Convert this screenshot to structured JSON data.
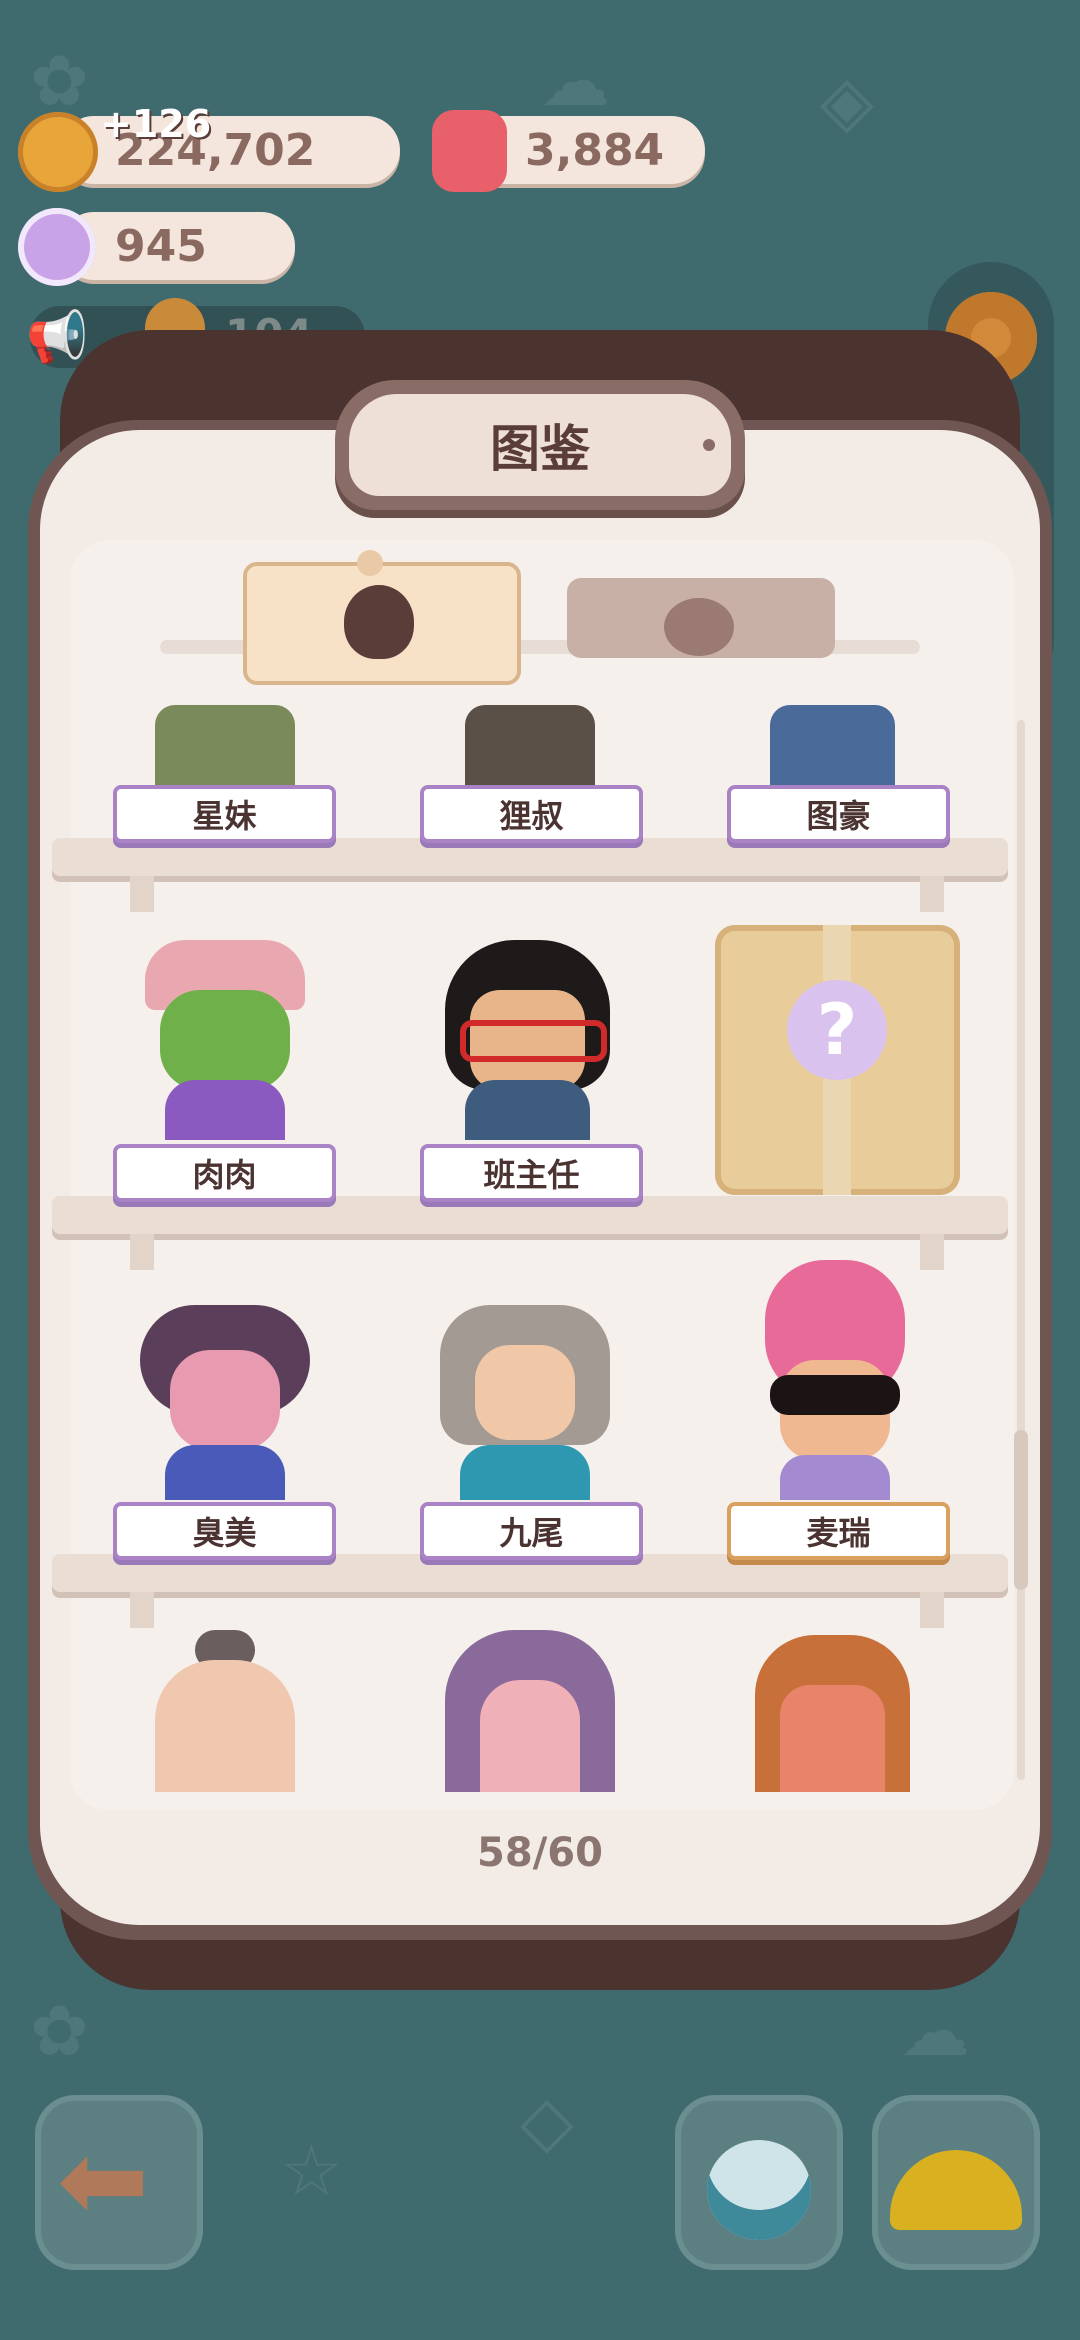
{
  "currencies": {
    "cookies": {
      "value": "224,702",
      "gain": "+126"
    },
    "jelly": {
      "value": "3,884"
    },
    "crystal": {
      "value": "945"
    }
  },
  "notice": {
    "value": "104"
  },
  "panel": {
    "title": "图鉴",
    "tabs": [
      {
        "icon": "character-face-icon",
        "active": true
      },
      {
        "icon": "pet-face-icon",
        "active": false
      }
    ],
    "rows": [
      [
        "星妹",
        "狸叔",
        "图豪"
      ],
      [
        "肉肉",
        "班主任",
        null
      ],
      [
        "臭美",
        "九尾",
        "麦瑞"
      ]
    ],
    "counter": "58/60"
  },
  "colors": {
    "background": "#3f6b6f",
    "panel": "#f3ebe6",
    "label_border": "#a983c6",
    "label_gold": "#d9a060"
  }
}
